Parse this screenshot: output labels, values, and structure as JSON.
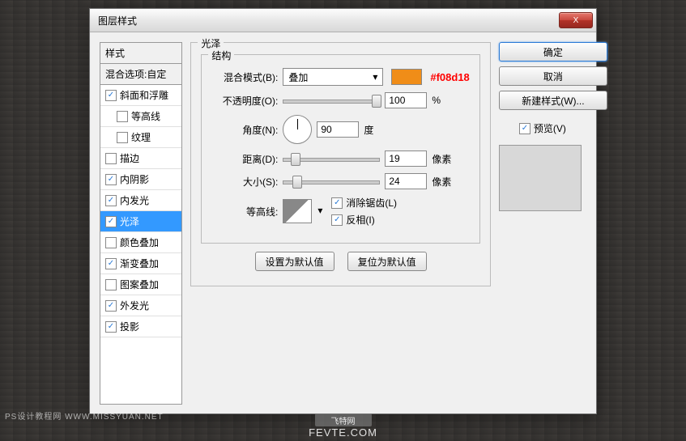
{
  "window": {
    "title": "图层样式",
    "close_icon": "X"
  },
  "style_list": {
    "header": "样式",
    "blend_header": "混合选项:自定",
    "items": [
      {
        "label": "斜面和浮雕",
        "checked": true,
        "indent": false
      },
      {
        "label": "等高线",
        "checked": false,
        "indent": true
      },
      {
        "label": "纹理",
        "checked": false,
        "indent": true
      },
      {
        "label": "描边",
        "checked": false,
        "indent": false
      },
      {
        "label": "内阴影",
        "checked": true,
        "indent": false
      },
      {
        "label": "内发光",
        "checked": true,
        "indent": false
      },
      {
        "label": "光泽",
        "checked": true,
        "indent": false,
        "selected": true
      },
      {
        "label": "颜色叠加",
        "checked": false,
        "indent": false
      },
      {
        "label": "渐变叠加",
        "checked": true,
        "indent": false
      },
      {
        "label": "图案叠加",
        "checked": false,
        "indent": false
      },
      {
        "label": "外发光",
        "checked": true,
        "indent": false
      },
      {
        "label": "投影",
        "checked": true,
        "indent": false
      }
    ]
  },
  "panel": {
    "title": "光泽",
    "structure_title": "结构",
    "blend_mode_label": "混合模式(B):",
    "blend_mode_value": "叠加",
    "color_hex": "#f08d18",
    "opacity_label": "不透明度(O):",
    "opacity_value": "100",
    "opacity_unit": "%",
    "angle_label": "角度(N):",
    "angle_value": "90",
    "angle_unit": "度",
    "distance_label": "距离(D):",
    "distance_value": "19",
    "distance_unit": "像素",
    "size_label": "大小(S):",
    "size_value": "24",
    "size_unit": "像素",
    "contour_label": "等高线:",
    "antialias_label": "消除锯齿(L)",
    "invert_label": "反相(I)",
    "set_default_btn": "设置为默认值",
    "reset_default_btn": "复位为默认值"
  },
  "buttons": {
    "ok": "确定",
    "cancel": "取消",
    "new_style": "新建样式(W)...",
    "preview": "预览(V)"
  },
  "watermarks": {
    "line1": "PS设计教程网  WWW.MISSYUAN.NET",
    "box": "飞特网",
    "line2": "FEVTE.COM"
  }
}
